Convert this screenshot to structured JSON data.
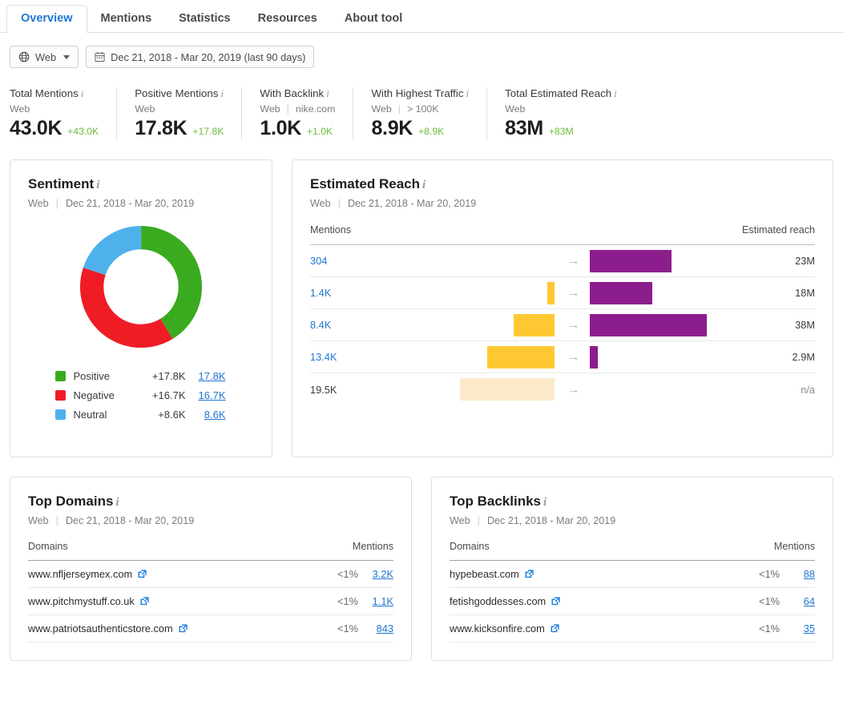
{
  "tabs": [
    {
      "label": "Overview",
      "active": true
    },
    {
      "label": "Mentions",
      "active": false
    },
    {
      "label": "Statistics",
      "active": false
    },
    {
      "label": "Resources",
      "active": false
    },
    {
      "label": "About tool",
      "active": false
    }
  ],
  "filters": {
    "source": "Web",
    "date_range": "Dec 21, 2018 - Mar 20, 2019 (last 90 days)"
  },
  "kpis": [
    {
      "title": "Total Mentions",
      "sub1": "Web",
      "sub2": "",
      "value": "43.0K",
      "delta": "+43.0K"
    },
    {
      "title": "Positive Mentions",
      "sub1": "Web",
      "sub2": "",
      "value": "17.8K",
      "delta": "+17.8K"
    },
    {
      "title": "With Backlink",
      "sub1": "Web",
      "sub2": "nike.com",
      "value": "1.0K",
      "delta": "+1.0K"
    },
    {
      "title": "With Highest Traffic",
      "sub1": "Web",
      "sub2": "> 100K",
      "value": "8.9K",
      "delta": "+8.9K"
    },
    {
      "title": "Total Estimated Reach",
      "sub1": "Web",
      "sub2": "",
      "value": "83M",
      "delta": "+83M"
    }
  ],
  "sentiment": {
    "title": "Sentiment",
    "meta_source": "Web",
    "meta_date": "Dec 21, 2018 - Mar 20, 2019",
    "legend": [
      {
        "name": "Positive",
        "delta": "+17.8K",
        "link": "17.8K",
        "color": "#3aaa1e"
      },
      {
        "name": "Negative",
        "delta": "+16.7K",
        "link": "16.7K",
        "color": "#ef1c26"
      },
      {
        "name": "Neutral",
        "delta": "+8.6K",
        "link": "8.6K",
        "color": "#4fb1ec"
      }
    ]
  },
  "reach": {
    "title": "Estimated Reach",
    "meta_source": "Web",
    "meta_date": "Dec 21, 2018 - Mar 20, 2019",
    "col_mentions": "Mentions",
    "col_reach": "Estimated reach",
    "rows": [
      {
        "mentions": "304",
        "reach": "23M",
        "left_w": 0,
        "right_w": 102,
        "pale": false,
        "is_na": false
      },
      {
        "mentions": "1.4K",
        "reach": "18M",
        "left_w": 9,
        "right_w": 78,
        "pale": false,
        "is_na": false
      },
      {
        "mentions": "8.4K",
        "reach": "38M",
        "left_w": 51,
        "right_w": 146,
        "pale": false,
        "is_na": false
      },
      {
        "mentions": "13.4K",
        "reach": "2.9M",
        "left_w": 84,
        "right_w": 10,
        "pale": false,
        "is_na": false
      },
      {
        "mentions": "19.5K",
        "reach": "n/a",
        "left_w": 118,
        "right_w": 0,
        "pale": true,
        "is_na": true
      }
    ]
  },
  "top_domains": {
    "title": "Top Domains",
    "meta_source": "Web",
    "meta_date": "Dec 21, 2018 - Mar 20, 2019",
    "col_domains": "Domains",
    "col_mentions": "Mentions",
    "rows": [
      {
        "domain": "www.nfljerseymex.com",
        "pct": "<1%",
        "count": "3.2K"
      },
      {
        "domain": "www.pitchmystuff.co.uk",
        "pct": "<1%",
        "count": "1.1K"
      },
      {
        "domain": "www.patriotsauthenticstore.com",
        "pct": "<1%",
        "count": "843"
      }
    ]
  },
  "top_backlinks": {
    "title": "Top Backlinks",
    "meta_source": "Web",
    "meta_date": "Dec 21, 2018 - Mar 20, 2019",
    "col_domains": "Domains",
    "col_mentions": "Mentions",
    "rows": [
      {
        "domain": "hypebeast.com",
        "pct": "<1%",
        "count": "88"
      },
      {
        "domain": "fetishgoddesses.com",
        "pct": "<1%",
        "count": "64"
      },
      {
        "domain": "www.kicksonfire.com",
        "pct": "<1%",
        "count": "35"
      }
    ]
  },
  "chart_data": [
    {
      "type": "pie",
      "title": "Sentiment",
      "labels": [
        "Positive",
        "Negative",
        "Neutral"
      ],
      "values": [
        17800,
        16700,
        8600
      ],
      "value_labels": [
        "17.8K",
        "16.7K",
        "8.6K"
      ],
      "percentages": [
        41.3,
        38.8,
        19.9
      ],
      "colors": [
        "#3aaa1e",
        "#ef1c26",
        "#4fb1ec"
      ],
      "donut": true,
      "legend_position": "bottom"
    },
    {
      "type": "bar",
      "title": "Estimated Reach",
      "orientation": "horizontal-diverging",
      "categories": [
        "304",
        "1.4K",
        "8.4K",
        "13.4K",
        "19.5K"
      ],
      "xlabel": "",
      "ylabel": "",
      "series": [
        {
          "name": "Mentions",
          "values": [
            304,
            1400,
            8400,
            13400,
            19500
          ],
          "color": "#ffc832"
        },
        {
          "name": "Estimated reach",
          "values": [
            23000000,
            18000000,
            38000000,
            2900000,
            null
          ],
          "value_labels": [
            "23M",
            "18M",
            "38M",
            "2.9M",
            "n/a"
          ],
          "color": "#8c1d8c"
        }
      ],
      "grid": false,
      "legend_position": "none"
    }
  ],
  "icons": {
    "globe": "globe-icon",
    "calendar": "calendar-icon",
    "external_link": "external-link-icon",
    "arrow_right": "arrow-right-icon",
    "info": "info-icon"
  }
}
